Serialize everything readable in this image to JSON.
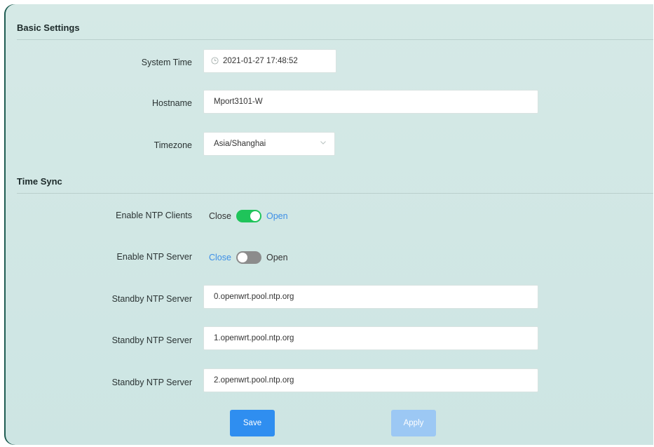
{
  "basic": {
    "title": "Basic Settings",
    "system_time_label": "System Time",
    "system_time_value": "2021-01-27 17:48:52",
    "hostname_label": "Hostname",
    "hostname_value": "Mport3101-W",
    "timezone_label": "Timezone",
    "timezone_value": "Asia/Shanghai"
  },
  "timesync": {
    "title": "Time Sync",
    "ntp_clients": {
      "label": "Enable NTP Clients",
      "off_label": "Close",
      "on_label": "Open",
      "state": "on",
      "color": "#1fc45a"
    },
    "ntp_server": {
      "label": "Enable NTP Server",
      "off_label": "Close",
      "on_label": "Open",
      "state": "off",
      "color": "#8c8c8c"
    },
    "standby_servers": [
      {
        "label": "Standby NTP Server",
        "value": "0.openwrt.pool.ntp.org"
      },
      {
        "label": "Standby NTP Server",
        "value": "1.openwrt.pool.ntp.org"
      },
      {
        "label": "Standby NTP Server",
        "value": "2.openwrt.pool.ntp.org"
      }
    ]
  },
  "actions": {
    "save_label": "Save",
    "apply_label": "Apply",
    "save_color": "#2f8ef0",
    "apply_color": "#9cc8f4"
  },
  "colors": {
    "accent_link": "#3d8fe6"
  }
}
